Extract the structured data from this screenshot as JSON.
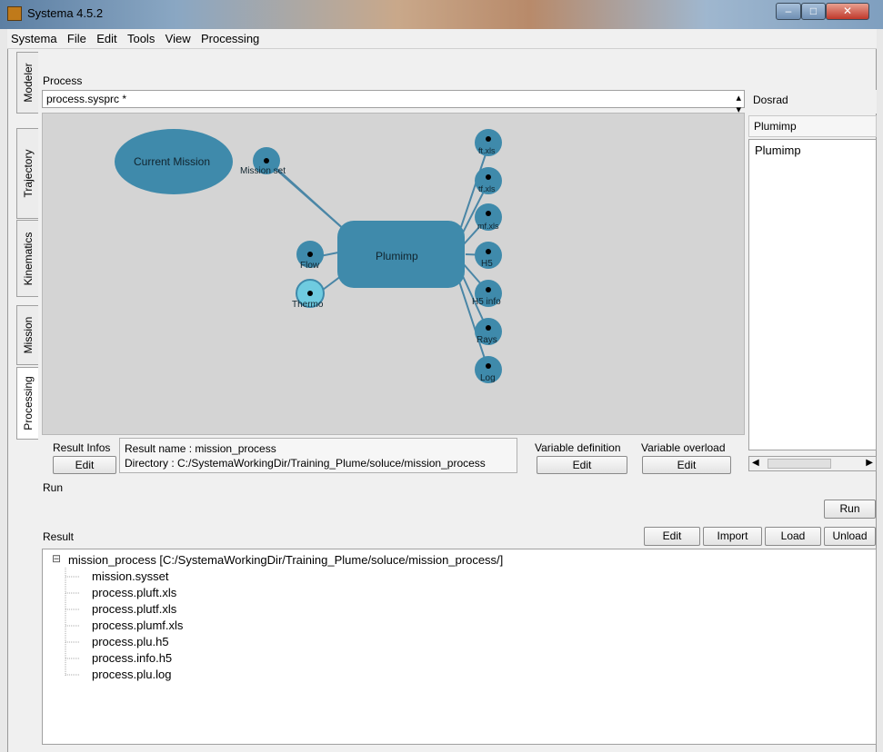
{
  "window": {
    "title": "Systema 4.5.2",
    "min": "‒",
    "max": "□",
    "close": "✕"
  },
  "menu": [
    "Systema",
    "File",
    "Edit",
    "Tools",
    "View",
    "Processing"
  ],
  "side_tabs": [
    "Modeler",
    "Trajectory",
    "Kinematics",
    "Mission",
    "Processing"
  ],
  "process": {
    "label": "Process",
    "selected": "process.sysprc *"
  },
  "graph": {
    "current_mission": "Current Mission",
    "mission_set": "Mission set",
    "plumimp": "Plumimp",
    "flow": "Flow",
    "thermo": "Thermo",
    "outputs": [
      "ft.xls",
      "tf.xls",
      "mf.xls",
      "H5",
      "H5 info",
      "Rays",
      "Log"
    ]
  },
  "result_infos": {
    "label": "Result Infos",
    "edit": "Edit",
    "name_line": "Result name : mission_process",
    "dir_line": "Directory : C:/SystemaWorkingDir/Training_Plume/soluce/mission_process"
  },
  "variable_definition": {
    "label": "Variable definition",
    "edit": "Edit"
  },
  "variable_overload": {
    "label": "Variable overload",
    "edit": "Edit"
  },
  "right_panel": {
    "items": [
      "Dosrad",
      "Plumimp"
    ],
    "list": [
      "Plumimp"
    ]
  },
  "run": {
    "label": "Run",
    "button": "Run"
  },
  "result": {
    "label": "Result",
    "buttons": [
      "Edit",
      "Import",
      "Load",
      "Unload"
    ],
    "root": "mission_process [C:/SystemaWorkingDir/Training_Plume/soluce/mission_process/]",
    "expander": "⊟",
    "files": [
      "mission.sysset",
      "process.pluft.xls",
      "process.plutf.xls",
      "process.plumf.xls",
      "process.plu.h5",
      "process.info.h5",
      "process.plu.log"
    ]
  }
}
